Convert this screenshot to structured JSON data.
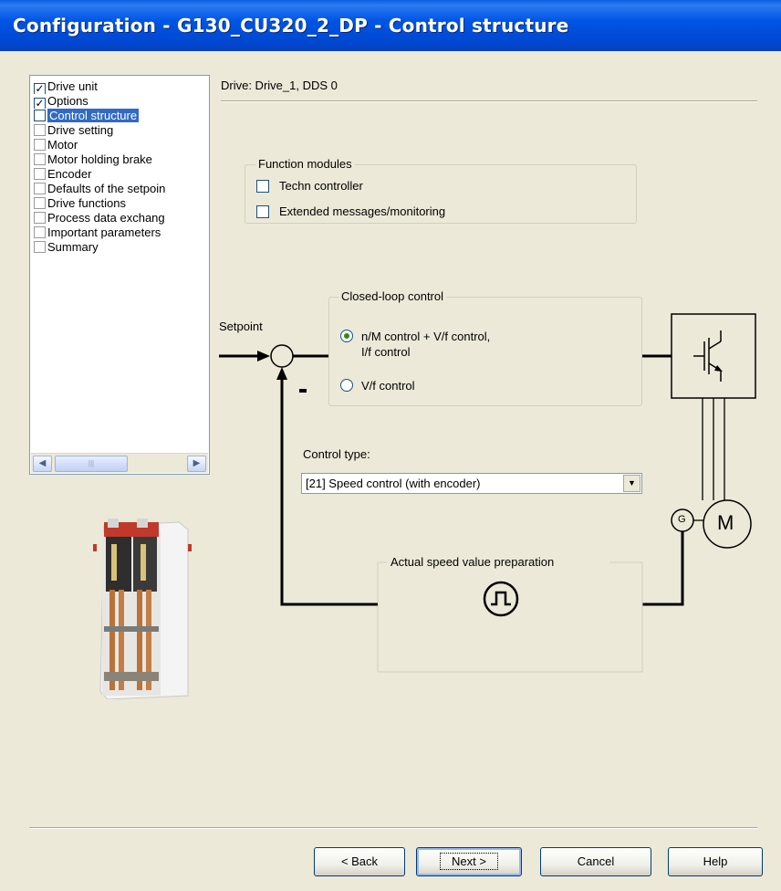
{
  "window": {
    "title": "Configuration - G130_CU320_2_DP - Control structure"
  },
  "nav": {
    "items": [
      {
        "label": "Drive unit",
        "checked": true
      },
      {
        "label": "Options",
        "checked": true
      },
      {
        "label": "Control structure",
        "checked": false,
        "selected": true
      },
      {
        "label": "Drive setting",
        "checked": false
      },
      {
        "label": "Motor",
        "checked": false
      },
      {
        "label": "Motor holding brake",
        "checked": false
      },
      {
        "label": "Encoder",
        "checked": false
      },
      {
        "label": "Defaults of the setpoin",
        "checked": false
      },
      {
        "label": "Drive functions",
        "checked": false
      },
      {
        "label": "Process data exchang",
        "checked": false
      },
      {
        "label": "Important parameters",
        "checked": false
      },
      {
        "label": "Summary",
        "checked": false
      }
    ]
  },
  "header": {
    "drive": "Drive: Drive_1, DDS 0"
  },
  "function_modules": {
    "title": "Function modules",
    "options": [
      {
        "label": "Techn controller",
        "checked": false
      },
      {
        "label": "Extended messages/monitoring",
        "checked": false
      }
    ]
  },
  "closed_loop": {
    "title": "Closed-loop control",
    "option1_line1": "n/M control + V/f control,",
    "option1_line2": "I/f control",
    "option2": "V/f control",
    "selected": "n/M control + V/f control, I/f control"
  },
  "diagram": {
    "setpoint": "Setpoint",
    "minus": "-",
    "motor": "M",
    "encoder": "G",
    "actual_speed": "Actual speed value preparation"
  },
  "control_type": {
    "label": "Control type:",
    "value": "[21] Speed control (with encoder)"
  },
  "buttons": {
    "back": "< Back",
    "next": "Next >",
    "cancel": "Cancel",
    "help": "Help"
  }
}
